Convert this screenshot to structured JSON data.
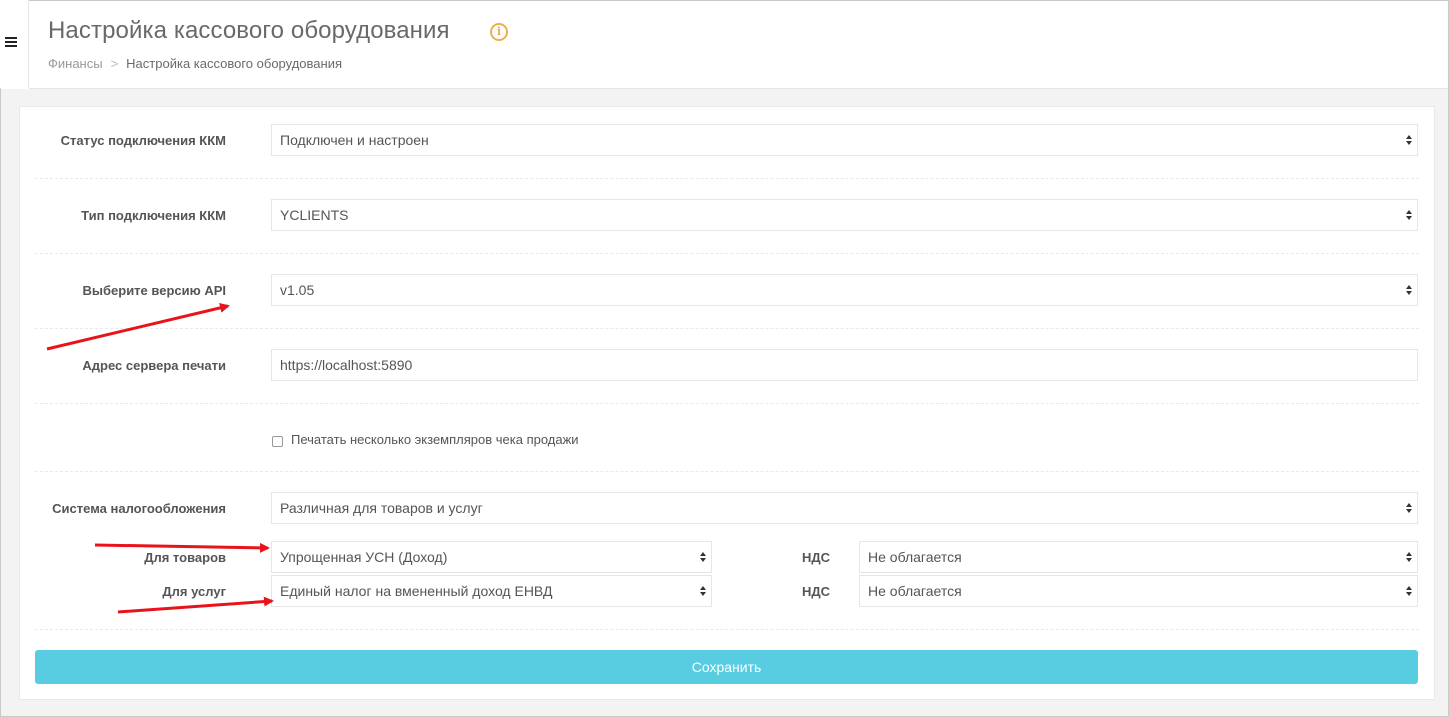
{
  "header": {
    "title": "Настройка кассового оборудования",
    "info_icon": "info-circle-icon",
    "breadcrumb": {
      "parent": "Финансы",
      "separator": ">",
      "current": "Настройка кассового оборудования"
    }
  },
  "form": {
    "status": {
      "label": "Статус подключения ККМ",
      "value": "Подключен и настроен"
    },
    "conn_type": {
      "label": "Тип подключения ККМ",
      "value": "YCLIENTS"
    },
    "api_version": {
      "label": "Выберите версию API",
      "value": "v1.05"
    },
    "print_server": {
      "label": "Адрес сервера печати",
      "value": "https://localhost:5890"
    },
    "multi_copies": {
      "label": "Печатать несколько экземпляров чека продажи",
      "checked": false
    },
    "tax_system": {
      "label": "Система налогообложения",
      "value": "Различная для товаров и услуг"
    },
    "goods": {
      "label": "Для товаров",
      "value": "Упрощенная УСН (Доход)",
      "vat_label": "НДС",
      "vat_value": "Не облагается"
    },
    "services": {
      "label": "Для услуг",
      "value": "Единый налог на вмененный доход ЕНВД",
      "vat_label": "НДС",
      "vat_value": "Не облагается"
    },
    "save_label": "Сохранить"
  },
  "colors": {
    "accent": "#58cde2",
    "annotation_arrow": "#e8141b",
    "info": "#f0ad4e"
  }
}
